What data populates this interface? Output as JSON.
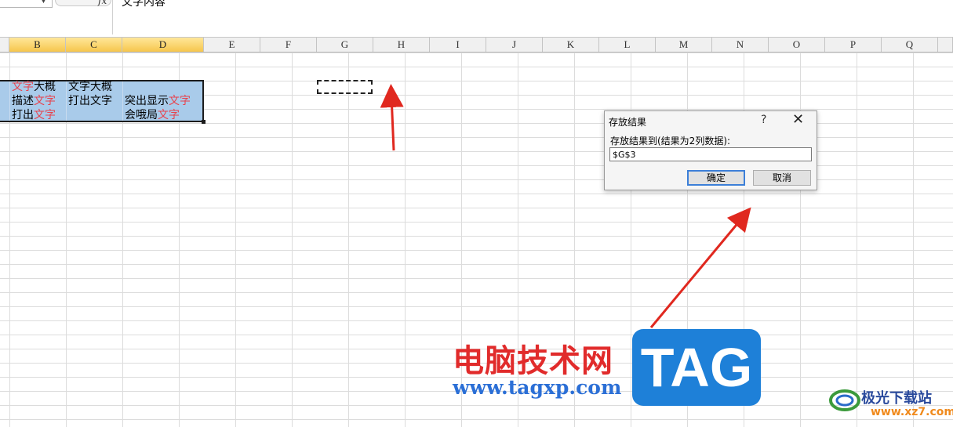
{
  "formula_bar": {
    "fx_symbol": "fx",
    "content": "文字内容"
  },
  "columns": [
    "B",
    "C",
    "D",
    "E",
    "F",
    "G",
    "H",
    "I",
    "J",
    "K",
    "L",
    "M",
    "N",
    "O",
    "P",
    "Q"
  ],
  "cells": {
    "row1": {
      "b_red": "文字",
      "b_black": "大概",
      "c": "文字大概"
    },
    "row2": {
      "b_black": "描述",
      "b_red": "文字",
      "c": "打出文字",
      "d_black": "突出显示",
      "d_red": "文字"
    },
    "row3": {
      "b_black": "打出",
      "b_red": "文字",
      "d_black": "会哦局",
      "d_red": "文字"
    }
  },
  "dialog": {
    "title": "存放结果",
    "help": "?",
    "close": "✕",
    "label": "存放结果到(结果为2列数据):",
    "value": "$G$3",
    "ok": "确定",
    "cancel": "取消"
  },
  "watermark": {
    "cn": "电脑技术网",
    "url": "www.tagxp.com",
    "tag": "TAG",
    "site_cn": "极光下载站",
    "site_url": "www.xz7.com"
  },
  "colors": {
    "accent_red": "#e8424c",
    "selection": "#a9cbea",
    "header_selected": "#ffd56e"
  }
}
